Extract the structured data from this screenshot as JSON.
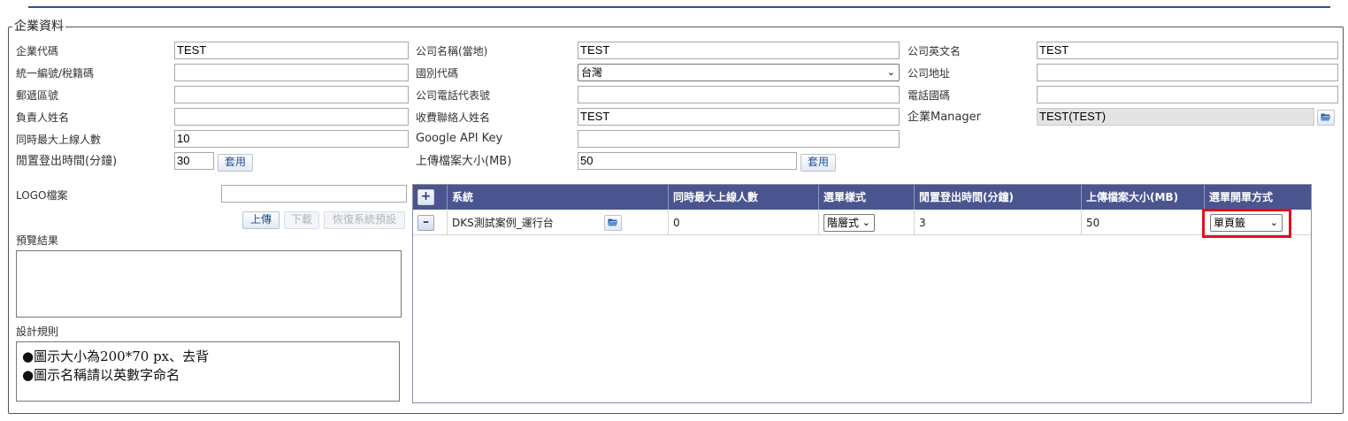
{
  "section": {
    "legend": "企業資料"
  },
  "form": {
    "col1": [
      {
        "label": "企業代碼",
        "value": "TEST"
      },
      {
        "label": "統一編號/稅籍碼",
        "value": ""
      },
      {
        "label": "郵遞區號",
        "value": ""
      },
      {
        "label": "負責人姓名",
        "value": ""
      },
      {
        "label": "同時最大上線人數",
        "value": "10"
      },
      {
        "label": "閒置登出時間(分鐘)",
        "value": "30",
        "button": "套用"
      }
    ],
    "col2": [
      {
        "label": "公司名稱(當地)",
        "value": "TEST"
      },
      {
        "label": "國別代碼",
        "value": "台灣"
      },
      {
        "label": "公司電話代表號",
        "value": ""
      },
      {
        "label": "收費聯絡人姓名",
        "value": "TEST"
      },
      {
        "label": "Google API Key",
        "value": ""
      },
      {
        "label": "上傳檔案大小(MB)",
        "value": "50",
        "button": "套用"
      }
    ],
    "col3": [
      {
        "label": "公司英文名",
        "value": "TEST"
      },
      {
        "label": "公司地址",
        "value": ""
      },
      {
        "label": "電話國碼",
        "value": ""
      },
      {
        "label": "企業Manager",
        "value": "TEST(TEST)"
      }
    ]
  },
  "logo": {
    "label": "LOGO檔案",
    "value": "",
    "upload": "上傳",
    "download": "下載",
    "restore": "恢復系統預設",
    "preview_label": "預覽結果",
    "rules_label": "設計規則",
    "rules": [
      "●圖示大小為200*70 px、去背",
      "●圖示名稱請以英數字命名"
    ]
  },
  "grid": {
    "columns": [
      "系統",
      "同時最大上線人數",
      "選單樣式",
      "閒置登出時間(分鐘)",
      "上傳檔案大小(MB)",
      "選單開單方式"
    ],
    "rows": [
      {
        "system": "DKS測試案例_運行台",
        "max_users": "0",
        "menu_style": "階層式",
        "idle_logout": "3",
        "upload_size": "50",
        "open_mode": "單頁籤"
      }
    ]
  },
  "colors": {
    "header": "#4a5590",
    "highlight": "#e4101c",
    "rule": "#3d4a8c"
  },
  "icons": {
    "add": "plus-icon",
    "remove": "minus-icon",
    "browse": "folder-open-icon",
    "dropdown": "chevron-down-icon"
  }
}
